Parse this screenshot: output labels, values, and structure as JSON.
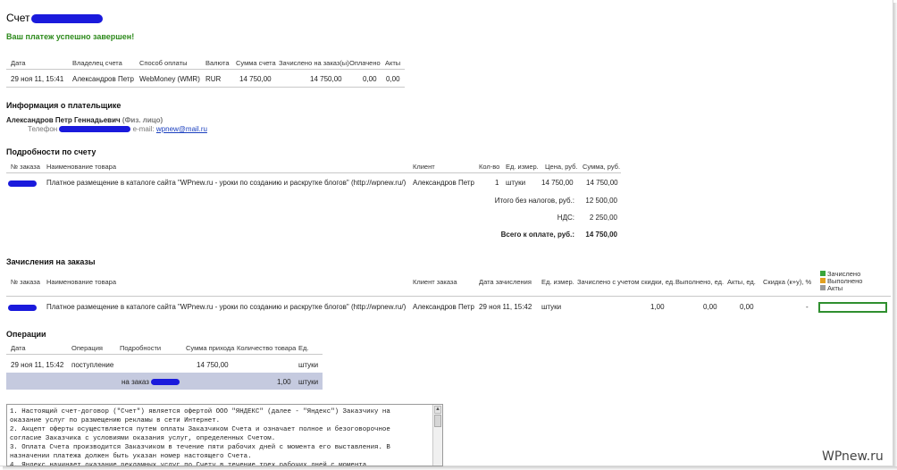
{
  "page": {
    "title": "Счет",
    "success_message": "Ваш платеж успешно завершен!"
  },
  "summary": {
    "headers": [
      "Дата",
      "Владелец счета",
      "Способ оплаты",
      "Валюта",
      "Сумма счета",
      "Зачислено на заказ(ы)",
      "Оплачено",
      "Акты"
    ],
    "row": [
      "29 ноя 11, 15:41",
      "Александров Петр",
      "WebMoney (WMR)",
      "RUR",
      "14 750,00",
      "14 750,00",
      "0,00",
      "0,00"
    ]
  },
  "payer": {
    "heading": "Информация о плательщике",
    "name": "Александров Петр Геннадьевич",
    "type": "(Физ. лицо)",
    "phone_label": "Телефон",
    "email_label": "e-mail:",
    "email": "wpnew@mail.ru"
  },
  "invoice": {
    "heading": "Подробности по счету",
    "headers": [
      "№ заказа",
      "Наименование товара",
      "Клиент",
      "Кол-во",
      "Ед. измер.",
      "Цена, руб.",
      "Сумма, руб."
    ],
    "row": {
      "product": "Платное размещение в каталоге сайта \"WPnew.ru - уроки по созданию и раскрутке блогов\" (http://wpnew.ru/)",
      "client": "Александров Петр",
      "qty": "1",
      "unit": "штуки",
      "price": "14 750,00",
      "sum": "14 750,00"
    },
    "totals": [
      {
        "label": "Итого без налогов, руб.:",
        "value": "12 500,00"
      },
      {
        "label": "НДС:",
        "value": "2 250,00"
      },
      {
        "label": "Всего к оплате, руб.:",
        "value": "14 750,00"
      }
    ]
  },
  "orders": {
    "heading": "Зачисления на заказы",
    "headers": [
      "№ заказа",
      "Наименование товара",
      "Клиент заказа",
      "Дата зачисления",
      "Ед. измер.",
      "Зачислено с учетом скидки, ед.",
      "Выполнено, ед.",
      "Акты, ед.",
      "Скидка (к+у), %"
    ],
    "legend": [
      {
        "label": "Зачислено",
        "color": "#3aa53a"
      },
      {
        "label": "Выполнено",
        "color": "#e2a020"
      },
      {
        "label": "Акты",
        "color": "#9a9a9a"
      }
    ],
    "row": {
      "product": "Платное размещение в каталоге сайта \"WPnew.ru - уроки по созданию и раскрутке блогов\" (http://wpnew.ru/)",
      "client": "Александров Петр",
      "date": "29 ноя 11, 15:42",
      "unit": "штуки",
      "credited": "1,00",
      "done": "0,00",
      "acts": "0,00",
      "discount": "-",
      "progress_fraction": 1.0
    }
  },
  "operations": {
    "heading": "Операции",
    "headers": [
      "Дата",
      "Операция",
      "Подробности",
      "Сумма прихода",
      "Количество товара",
      "Ед."
    ],
    "row1": [
      "29 ноя 11, 15:42",
      "поступление",
      "",
      "14 750,00",
      "",
      "штуки"
    ],
    "row2": {
      "details": "на заказ",
      "qty": "1,00",
      "unit": "штуки"
    }
  },
  "terms": "1. Настоящий счет-договор (\"Счет\") является офертой ООО \"ЯНДЕКС\" (далее - \"Яндекс\") Заказчику на\nоказание услуг по размещению рекламы в сети Интернет.\n2. Акцепт оферты осуществляется путем оплаты Заказчиком Счета и означает полное и безоговорочное\nсогласие Заказчика с условиями оказания услуг, определенных Счетом.\n3. Оплата Счета производится Заказчиком в течение пяти рабочих дней с момента его выставления. В\nназначении платежа должен быть указан номер настоящего Счета.\n4. Яндекс начинает оказание рекламных услуг по Счету в течение трех рабочих дней с момента",
  "watermark": "WPnew.ru"
}
